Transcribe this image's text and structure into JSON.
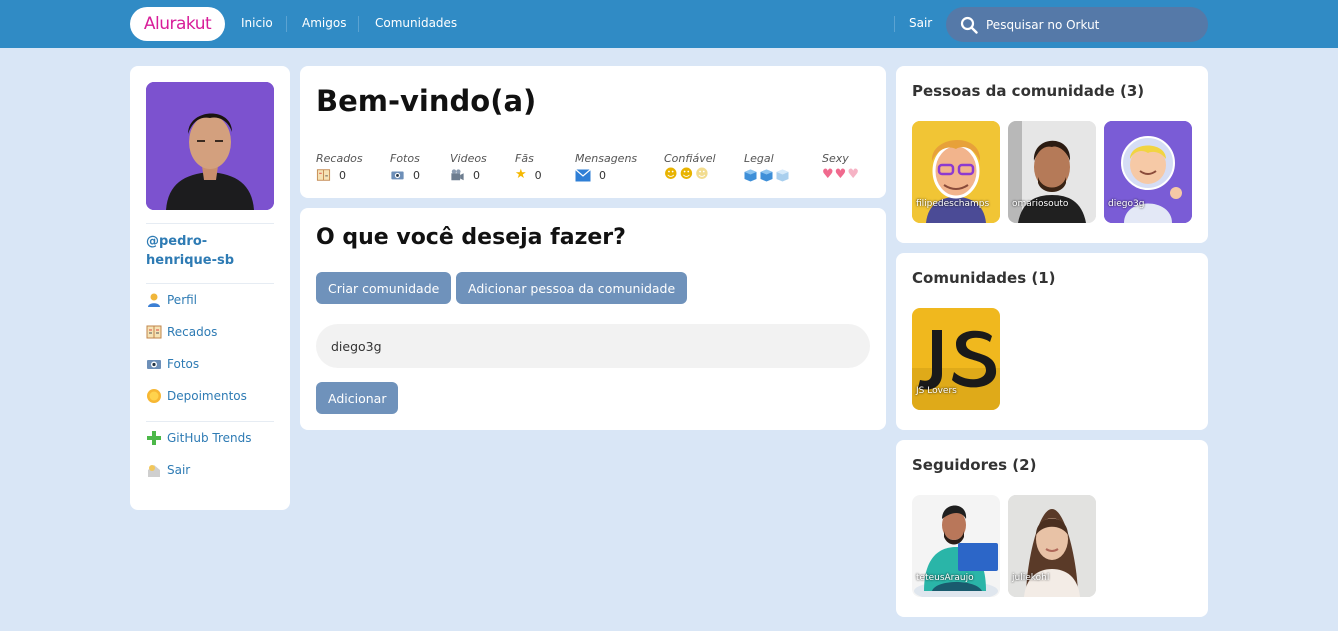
{
  "topbar": {
    "logo": "Alurakut",
    "nav": [
      "Inicio",
      "Amigos",
      "Comunidades"
    ],
    "logout": "Sair",
    "search_placeholder": "Pesquisar no Orkut"
  },
  "sidebar": {
    "username": "@pedro-henrique-sb",
    "menu": [
      {
        "label": "Perfil",
        "icon": "user-icon"
      },
      {
        "label": "Recados",
        "icon": "notebook-icon"
      },
      {
        "label": "Fotos",
        "icon": "camera-icon"
      },
      {
        "label": "Depoimentos",
        "icon": "sun-icon"
      },
      {
        "label": "GitHub Trends",
        "icon": "plus-icon"
      },
      {
        "label": "Sair",
        "icon": "logout-icon"
      }
    ]
  },
  "welcome": {
    "title": "Bem-vindo(a)",
    "stats": [
      {
        "label": "Recados",
        "value": "0",
        "icon": "notebook-icon"
      },
      {
        "label": "Fotos",
        "value": "0",
        "icon": "camera-icon"
      },
      {
        "label": "Videos",
        "value": "0",
        "icon": "video-camera-icon"
      },
      {
        "label": "Fãs",
        "value": "0",
        "icon": "star-icon"
      },
      {
        "label": "Mensagens",
        "value": "0",
        "icon": "envelope-icon"
      }
    ],
    "ratings": [
      {
        "label": "Confiável",
        "icon": "smiley-icon",
        "level": 2,
        "max": 3
      },
      {
        "label": "Legal",
        "icon": "ice-cube-icon",
        "level": 2,
        "max": 3
      },
      {
        "label": "Sexy",
        "icon": "heart-icon",
        "level": 2,
        "max": 3
      }
    ]
  },
  "actions": {
    "title": "O que você deseja fazer?",
    "create_community": "Criar comunidade",
    "add_person": "Adicionar pessoa da comunidade",
    "input_value": "diego3g",
    "add_button": "Adicionar"
  },
  "people": {
    "title": "Pessoas da comunidade (3)",
    "items": [
      "filipedeschamps",
      "omariosouto",
      "diego3g"
    ]
  },
  "communities": {
    "title": "Comunidades (1)",
    "items": [
      "JS Lovers"
    ]
  },
  "followers": {
    "title": "Seguidores (2)",
    "items": [
      "teteusAraujo",
      "juliekohl"
    ]
  },
  "colors": {
    "topbar": "#308bc5",
    "background": "#d9e6f6",
    "logo_text": "#d81d99",
    "link": "#2e7bb4",
    "button": "#6f92bb"
  }
}
